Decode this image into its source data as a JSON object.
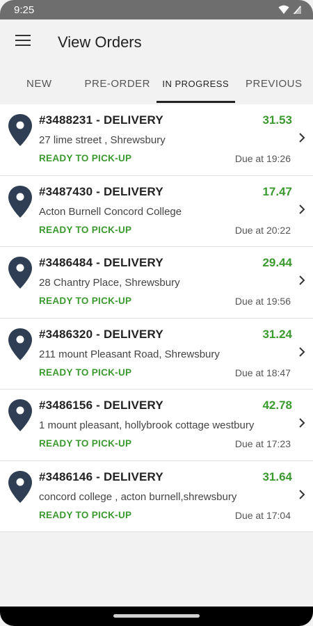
{
  "status_bar": {
    "time": "9:25"
  },
  "header": {
    "title": "View Orders"
  },
  "tabs": [
    {
      "label": "NEW"
    },
    {
      "label": "PRE-ORDER"
    },
    {
      "label": "IN PROGRESS"
    },
    {
      "label": "PREVIOUS"
    }
  ],
  "active_tab": "IN PROGRESS",
  "colors": {
    "accent_green": "#3a9a2e",
    "pin": "#2f3e52"
  },
  "orders": [
    {
      "id": "#3488231 - DELIVERY",
      "amount": "31.53",
      "address": "27 lime street , Shrewsbury",
      "status": "READY TO PICK-UP",
      "due": "Due at 19:26"
    },
    {
      "id": "#3487430 - DELIVERY",
      "amount": "17.47",
      "address": "Acton Burnell Concord College",
      "status": "READY TO PICK-UP",
      "due": "Due at 20:22"
    },
    {
      "id": "#3486484 - DELIVERY",
      "amount": "29.44",
      "address": "28 Chantry Place, Shrewsbury",
      "status": "READY TO PICK-UP",
      "due": "Due at 19:56"
    },
    {
      "id": "#3486320 - DELIVERY",
      "amount": "31.24",
      "address": "211 mount Pleasant Road, Shrewsbury",
      "status": "READY TO PICK-UP",
      "due": "Due at 18:47"
    },
    {
      "id": "#3486156 - DELIVERY",
      "amount": "42.78",
      "address": "1 mount pleasant, hollybrook cottage westbury",
      "status": "READY TO PICK-UP",
      "due": "Due at 17:23"
    },
    {
      "id": "#3486146 - DELIVERY",
      "amount": "31.64",
      "address": "concord college , acton burnell,shrewsbury",
      "status": "READY TO PICK-UP",
      "due": "Due at 17:04"
    }
  ]
}
